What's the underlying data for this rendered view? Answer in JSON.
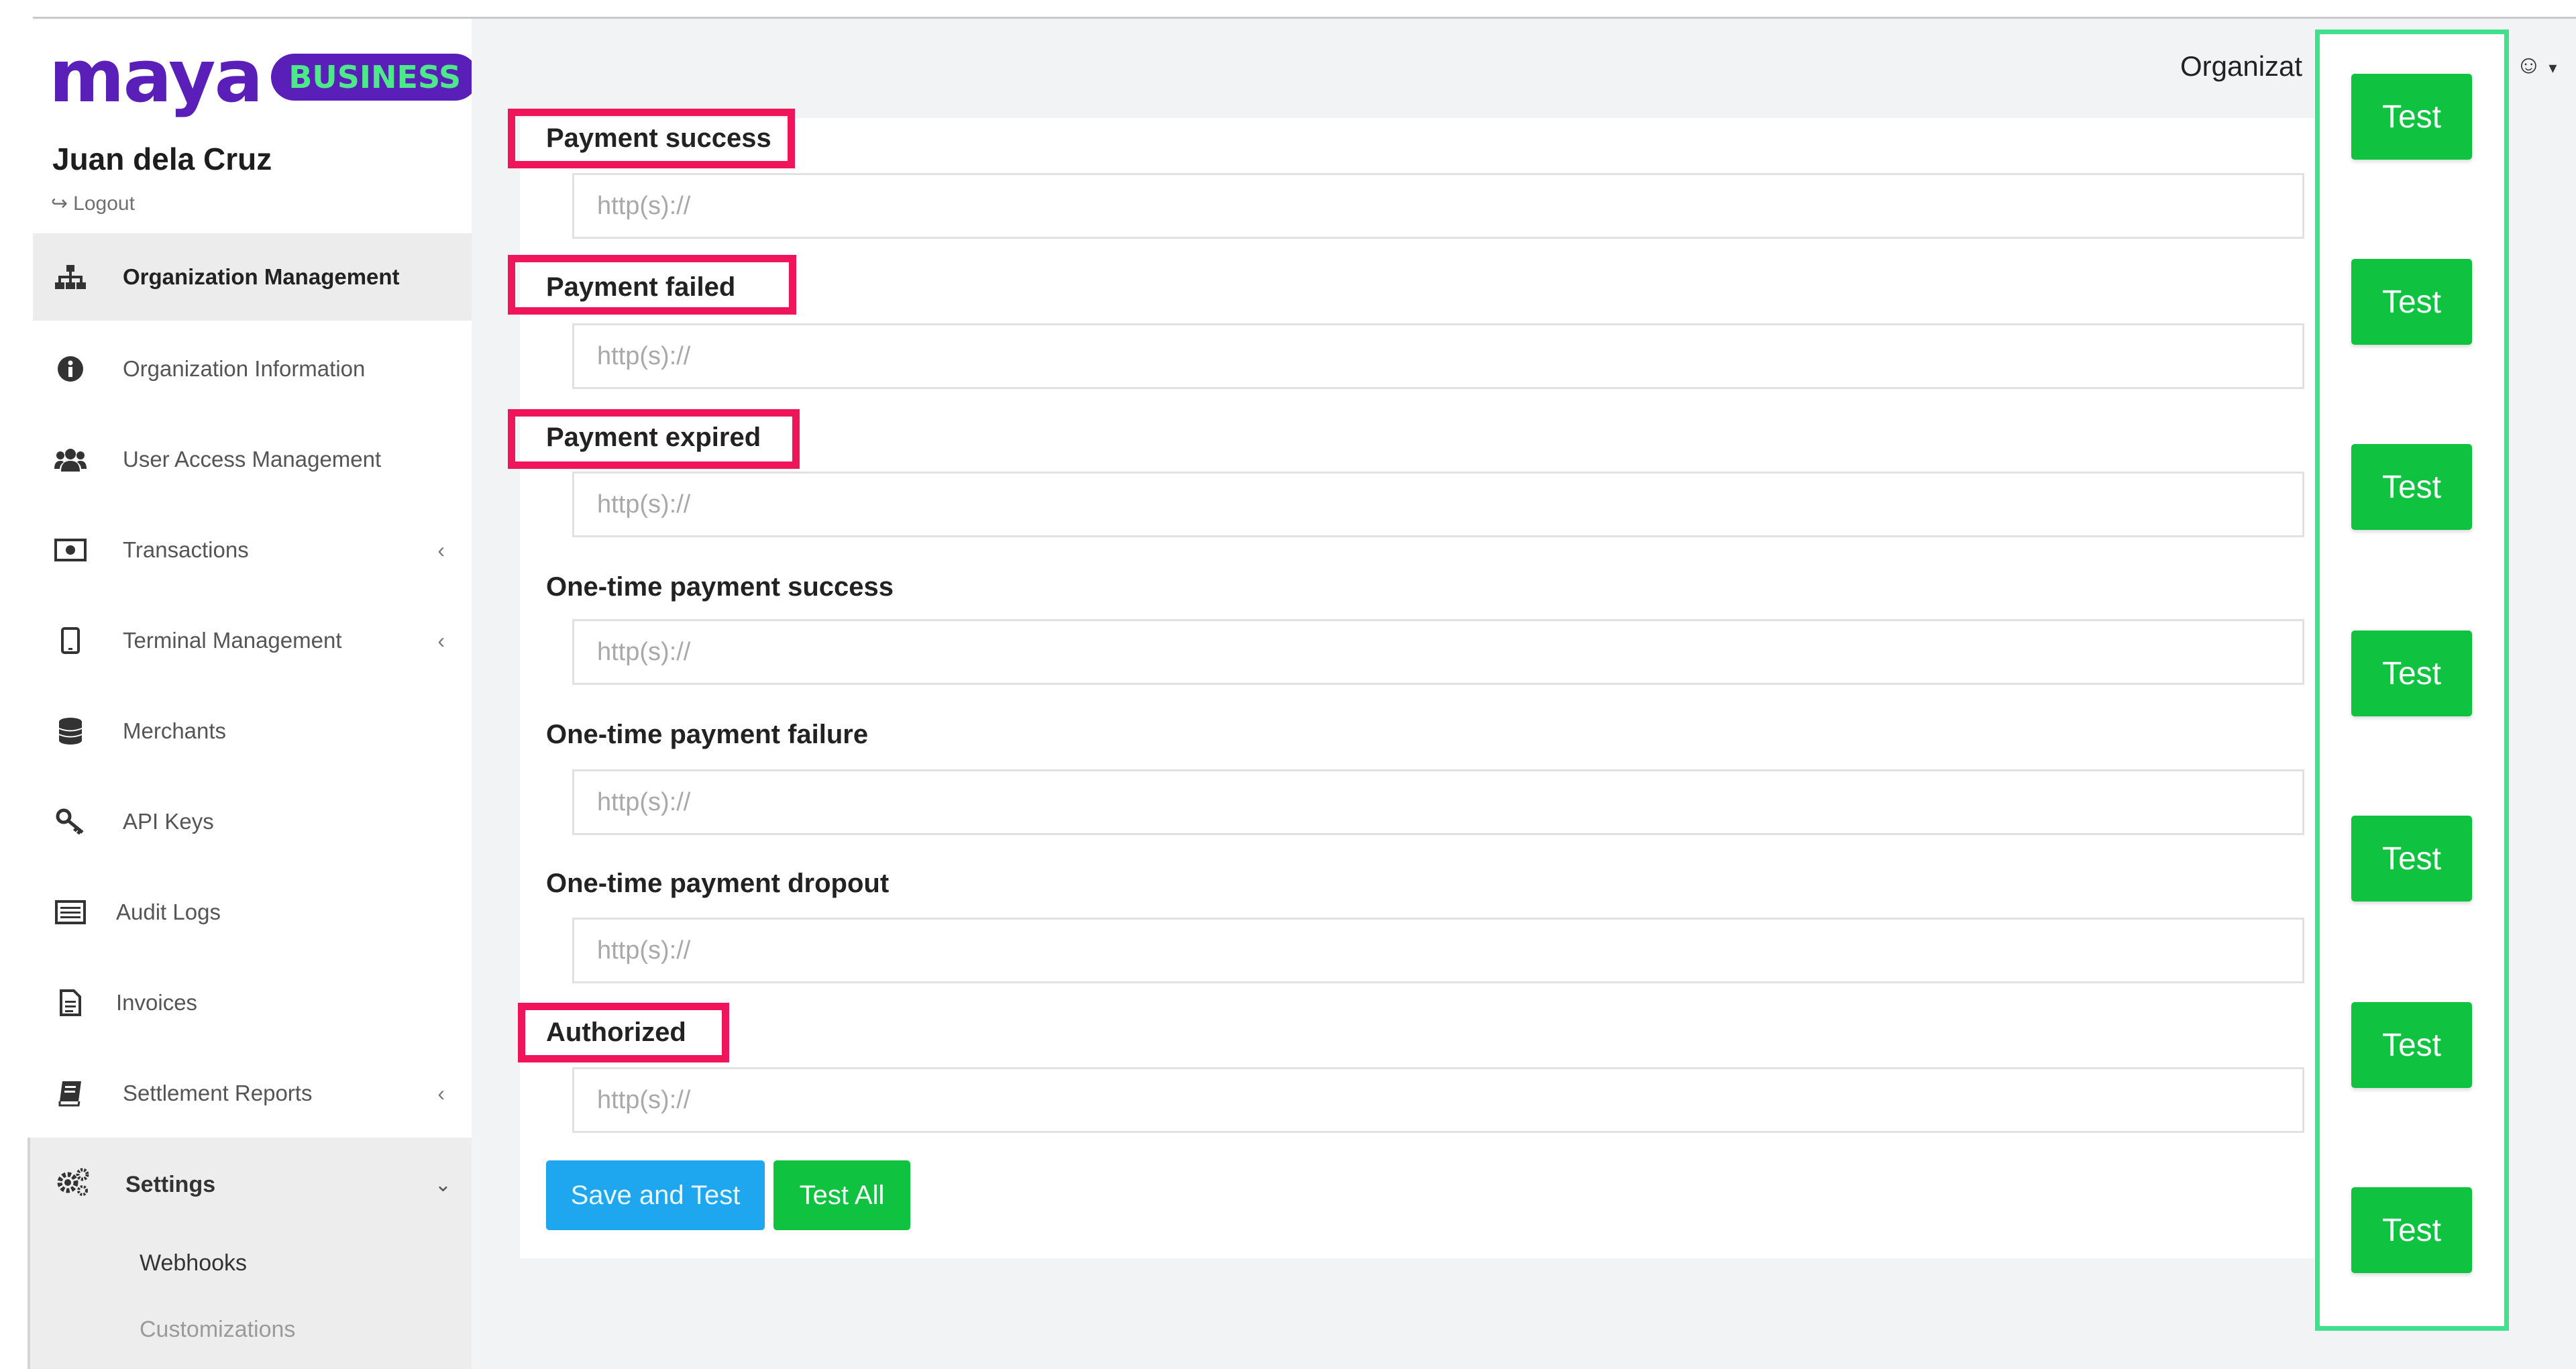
{
  "brand": {
    "logo_text": "maya",
    "badge_text": "BUSINESS"
  },
  "user": {
    "name": "Juan dela Cruz",
    "logout_label": "Logout"
  },
  "header": {
    "organization_label": "Organizat"
  },
  "sidebar": {
    "items": [
      {
        "label": "Organization Management",
        "icon": "sitemap-icon",
        "active": true,
        "has_chevron": false
      },
      {
        "label": "Organization Information",
        "icon": "info-circle-icon",
        "active": false,
        "has_chevron": false
      },
      {
        "label": "User Access Management",
        "icon": "users-icon",
        "active": false,
        "has_chevron": false
      },
      {
        "label": "Transactions",
        "icon": "money-icon",
        "active": false,
        "has_chevron": true
      },
      {
        "label": "Terminal Management",
        "icon": "tablet-icon",
        "active": false,
        "has_chevron": true
      },
      {
        "label": "Merchants",
        "icon": "database-icon",
        "active": false,
        "has_chevron": false
      },
      {
        "label": "API Keys",
        "icon": "key-icon",
        "active": false,
        "has_chevron": false
      },
      {
        "label": "Audit Logs",
        "icon": "list-alt-icon",
        "active": false,
        "has_chevron": false
      },
      {
        "label": "Invoices",
        "icon": "file-text-icon",
        "active": false,
        "has_chevron": false
      },
      {
        "label": "Settlement Reports",
        "icon": "book-icon",
        "active": false,
        "has_chevron": true
      }
    ],
    "settings": {
      "label": "Settings",
      "icon": "gears-icon",
      "expanded": true,
      "sub_items": [
        "Webhooks",
        "Customizations"
      ]
    }
  },
  "webhooks": {
    "fields": [
      {
        "label": "Payment success",
        "placeholder": "http(s)://",
        "highlighted": true
      },
      {
        "label": "Payment failed",
        "placeholder": "http(s)://",
        "highlighted": true
      },
      {
        "label": "Payment expired",
        "placeholder": "http(s)://",
        "highlighted": true
      },
      {
        "label": "One-time payment success",
        "placeholder": "http(s)://",
        "highlighted": false
      },
      {
        "label": "One-time payment failure",
        "placeholder": "http(s)://",
        "highlighted": false
      },
      {
        "label": "One-time payment dropout",
        "placeholder": "http(s)://",
        "highlighted": false
      },
      {
        "label": "Authorized",
        "placeholder": "http(s)://",
        "highlighted": true
      }
    ],
    "save_and_test_label": "Save and Test",
    "test_all_label": "Test All",
    "test_button_label": "Test"
  },
  "colors": {
    "brand_purple": "#5a1fb8",
    "brand_green": "#4de88a",
    "highlight_red": "#f0145a",
    "highlight_green": "#3fe08e",
    "button_green": "#0fc240",
    "button_blue": "#1ea7ef"
  }
}
